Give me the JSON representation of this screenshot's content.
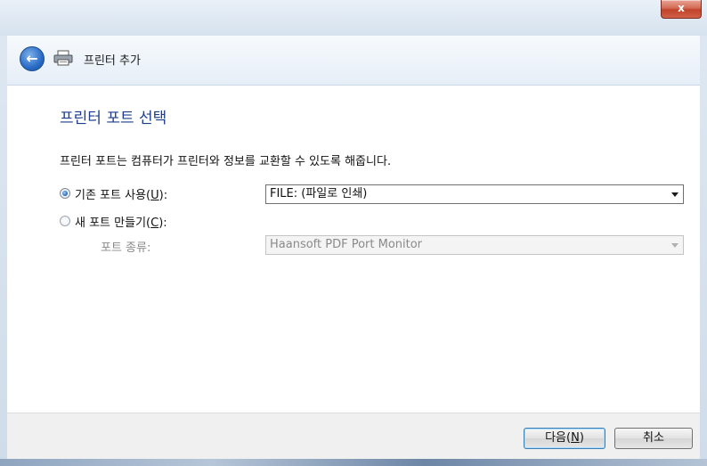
{
  "window": {
    "close_label": "x"
  },
  "nav": {
    "back_glyph": "←",
    "title": "프린터 추가",
    "icon": "printer-icon"
  },
  "page": {
    "heading": "프린터 포트 선택",
    "description": "프린터 포트는 컴퓨터가 프린터와 정보를 교환할 수 있도록 해줍니다."
  },
  "options": {
    "existing": {
      "label_prefix": "기존 포트 사용(",
      "accel": "U",
      "label_suffix": "):",
      "selected": true
    },
    "existing_port": {
      "value": "FILE: (파일로 인쇄)"
    },
    "create": {
      "label_prefix": "새 포트 만들기(",
      "accel": "C",
      "label_suffix": "):",
      "selected": false
    },
    "port_type": {
      "label": "포트 종류:",
      "value": "Haansoft PDF Port Monitor"
    }
  },
  "buttons": {
    "next": {
      "prefix": "다음(",
      "accel": "N",
      "suffix": ")"
    },
    "cancel": {
      "label": "취소"
    }
  },
  "colors": {
    "heading": "#1c3e8c",
    "close": "#c1432a",
    "accent": "#2a6bc6"
  }
}
